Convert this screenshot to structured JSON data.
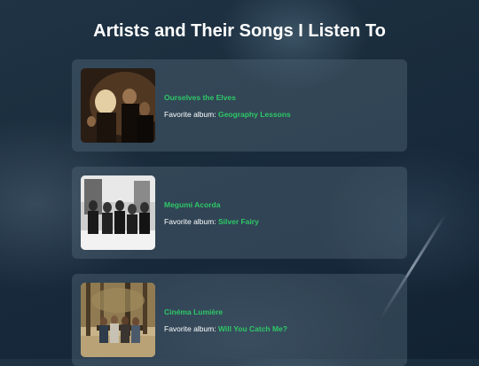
{
  "page": {
    "title": "Artists and Their Songs I Listen To"
  },
  "accent_color": "#2ec866",
  "artists": [
    {
      "name": "Ourselves the Elves",
      "favorite_label": "Favorite album:",
      "album": "Geography Lessons"
    },
    {
      "name": "Megumi Acorda",
      "favorite_label": "Favorite album:",
      "album": "Silver Fairy"
    },
    {
      "name": "Cinéma Lumière",
      "favorite_label": "Favorite album:",
      "album": "Will You Catch Me?"
    }
  ]
}
